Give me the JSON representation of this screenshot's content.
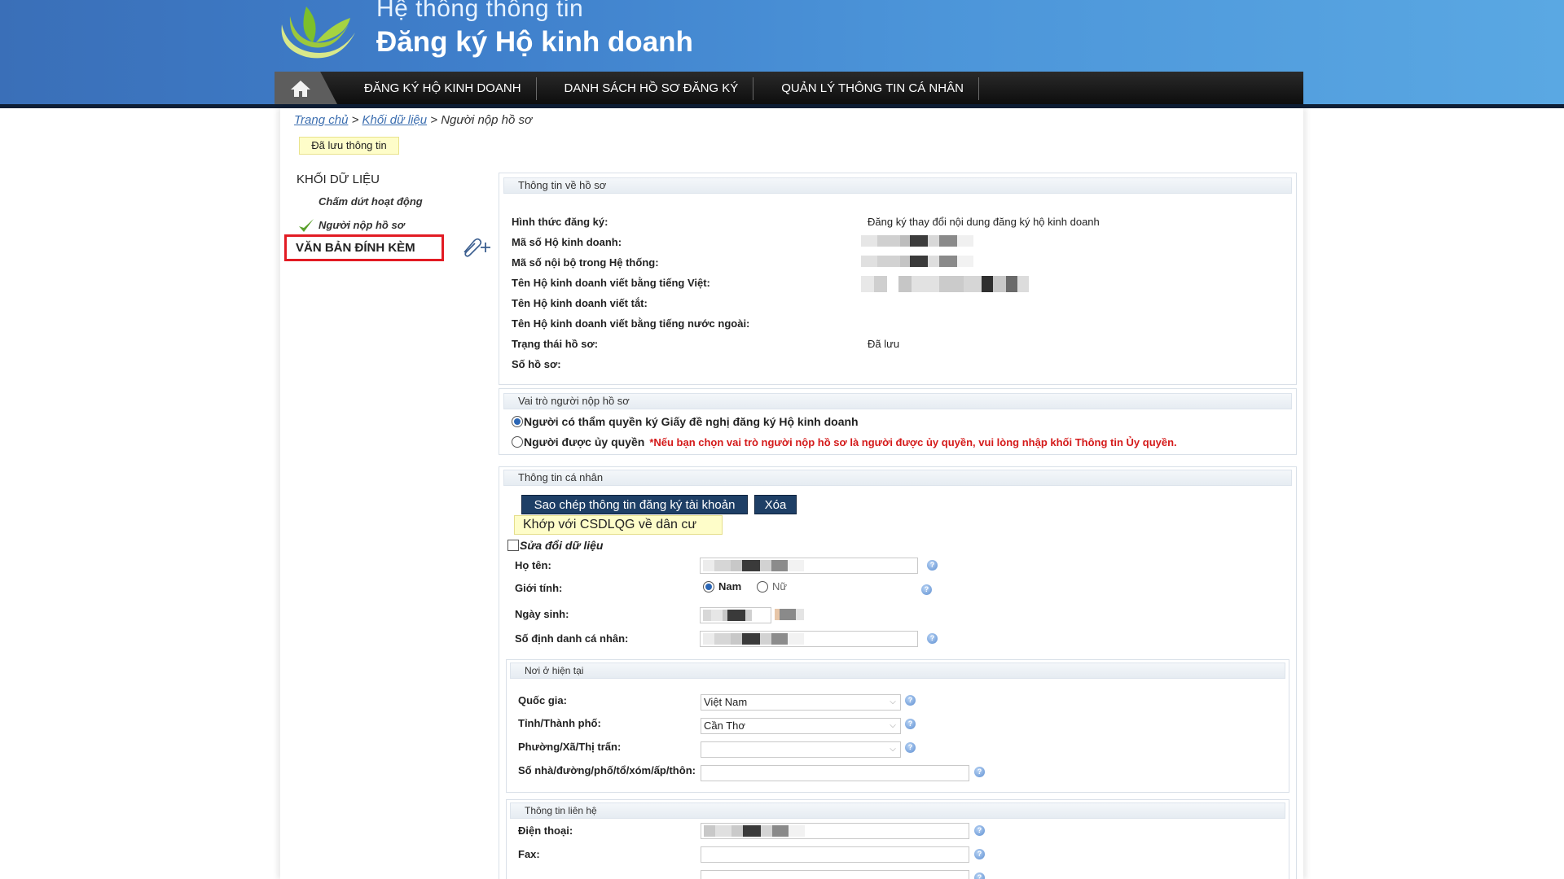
{
  "header": {
    "system_title": "Hệ thống thông tin",
    "system_subtitle": "Đăng ký Hộ kinh doanh"
  },
  "nav": {
    "home_icon": "home-icon",
    "items": [
      "ĐĂNG KÝ HỘ KINH DOANH",
      "DANH SÁCH HỒ SƠ ĐĂNG KÝ",
      "QUẢN LÝ THÔNG TIN CÁ NHÂN"
    ]
  },
  "breadcrumb": {
    "home": "Trang chủ",
    "sep1": ">",
    "data_block": "Khối dữ liệu",
    "sep2": ">",
    "current": "Người nộp hồ sơ"
  },
  "saved_notice": "Đã lưu thông tin",
  "sidebar": {
    "title": "KHỐI DỮ LIỆU",
    "items": [
      "Chấm dứt hoạt động",
      "Người nộp hồ sơ"
    ],
    "attachments": "VĂN BẢN ĐÍNH KÈM",
    "attach_icon": "attach-add-icon"
  },
  "dossier": {
    "header": "Thông tin về hồ sơ",
    "registration_type_label": "Hình thức đăng ký:",
    "registration_type_value": "Đăng ký thay đổi nội dung đăng ký hộ kinh doanh",
    "business_code_label": "Mã số Hộ kinh doanh:",
    "internal_code_label": "Mã số nội bộ trong Hệ thống:",
    "name_vn_label": "Tên Hộ kinh doanh viết bằng tiếng Việt:",
    "name_short_label": "Tên Hộ kinh doanh viết tắt:",
    "name_foreign_label": "Tên Hộ kinh doanh viết bằng tiếng nước ngoài:",
    "status_label": "Trạng thái hồ sơ:",
    "status_value": "Đã lưu",
    "dossier_no_label": "Số hồ sơ:"
  },
  "role": {
    "header": "Vai trò người nộp hồ sơ",
    "option1": "Người có thẩm quyền ký Giấy đề nghị đăng ký Hộ kinh doanh",
    "option2": "Người được ủy quyền",
    "note": "*Nếu bạn chọn vai trò người nộp hồ sơ là người được ủy quyền, vui lòng nhập khối Thông tin Ủy quyền."
  },
  "personal": {
    "header": "Thông tin cá nhân",
    "copy_button": "Sao chép thông tin đăng ký tài khoản",
    "delete_button": "Xóa",
    "match_notice": "Khớp với CSDLQG về dân cư",
    "edit_checkbox": "Sửa đổi dữ liệu",
    "full_name_label": "Họ tên:",
    "gender_label": "Giới tính:",
    "gender_male": "Nam",
    "gender_female": "Nữ",
    "dob_label": "Ngày sinh:",
    "id_label": "Số định danh cá nhân:"
  },
  "residence": {
    "header": "Nơi ở hiện tại",
    "country_label": "Quốc gia:",
    "country_value": "Việt Nam",
    "province_label": "Tỉnh/Thành phố:",
    "province_value": "Cần Thơ",
    "ward_label": "Phường/Xã/Thị trấn:",
    "ward_value": "",
    "address_label": "Số nhà/đường/phố/tổ/xóm/ấp/thôn:",
    "address_value": ""
  },
  "contact": {
    "header": "Thông tin liên hệ",
    "phone_label": "Điện thoại:",
    "fax_label": "Fax:",
    "fax_value": ""
  },
  "colors": {
    "header_blue": "#3f7fcb",
    "nav_black": "#111111",
    "dark_button": "#1e3f66",
    "highlight_red": "#e21b23",
    "note_red": "#d41a1a",
    "notice_yellow": "#fefdc9"
  }
}
